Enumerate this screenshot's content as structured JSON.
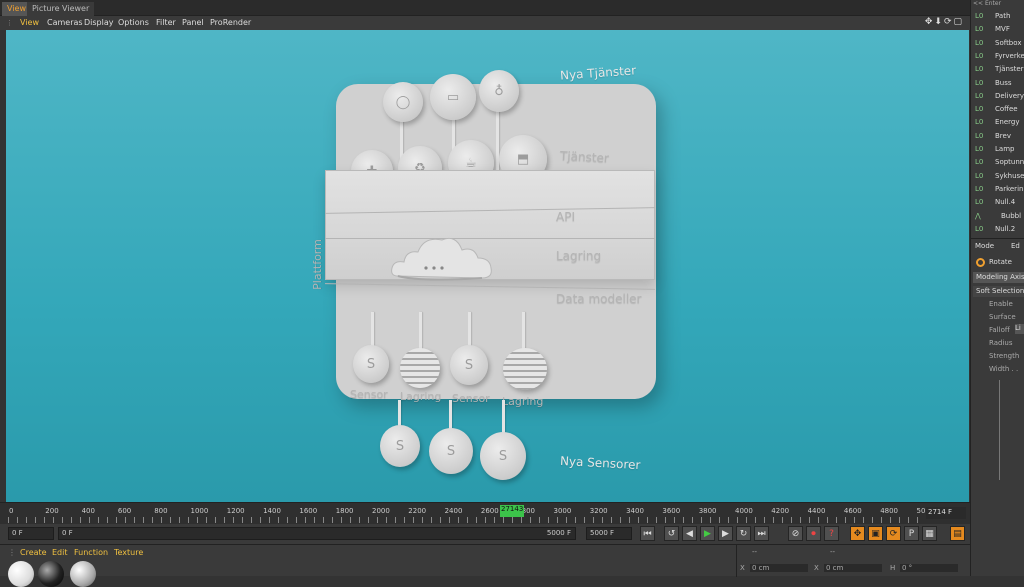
{
  "tabs": [
    "View",
    "Picture Viewer"
  ],
  "menu": [
    "View",
    "Cameras",
    "Display",
    "Options",
    "Filter",
    "Panel",
    "ProRender"
  ],
  "scene": {
    "title_top": "Nya Tjänster",
    "title_services": "Tjänster",
    "api": "API",
    "storage": "Lagring",
    "data_models": "Data modeller",
    "platform": "Plattform",
    "title_bottom": "Nya Sensorer",
    "sensor_labels": [
      "Sensor",
      "Lagring",
      "Sensor",
      "Lagring"
    ],
    "sensor_glyph": "S"
  },
  "object_manager": {
    "filter": "<< Enter",
    "objects": [
      "Path",
      "MVF",
      "Softbox",
      "Fyrverke",
      "Tjänster",
      "Buss",
      "Delivery",
      "Coffee",
      "Energy",
      "Brev",
      "Lamp",
      "Soptunn",
      "Sykhuse",
      "Parkerin",
      "Null.4",
      "Bubbl",
      "Null.2"
    ]
  },
  "attributes": {
    "mode_tabs": [
      "Mode",
      "Ed"
    ],
    "tool": "Rotate",
    "modeling_axis": "Modeling Axis",
    "soft_selection": "Soft Selection",
    "fields": [
      "Enable",
      "Surface",
      "Falloff",
      "Radius",
      "Strength",
      "Width . ."
    ],
    "falloff_value": "Li"
  },
  "timeline": {
    "ticks": [
      "0",
      "200",
      "400",
      "600",
      "800",
      "1000",
      "1200",
      "1400",
      "1600",
      "1800",
      "2000",
      "2200",
      "2400",
      "2600",
      "2800",
      "3000",
      "3200",
      "3400",
      "3600",
      "3800",
      "4000",
      "4200",
      "4400",
      "4600",
      "4800",
      "50"
    ],
    "current_frame": "27143",
    "current_frame_field": "2714 F",
    "start_field": "0 F",
    "range_start": "0 F",
    "range_end": "5000 F",
    "end_field": "5000 F"
  },
  "material_menu": [
    "Create",
    "Edit",
    "Function",
    "Texture"
  ],
  "coords": {
    "x1": "X",
    "x1_val": "0 cm",
    "x2": "X",
    "x2_val": "0 cm",
    "h": "H",
    "h_val": "0 °",
    "header1": "--",
    "header2": "--"
  }
}
